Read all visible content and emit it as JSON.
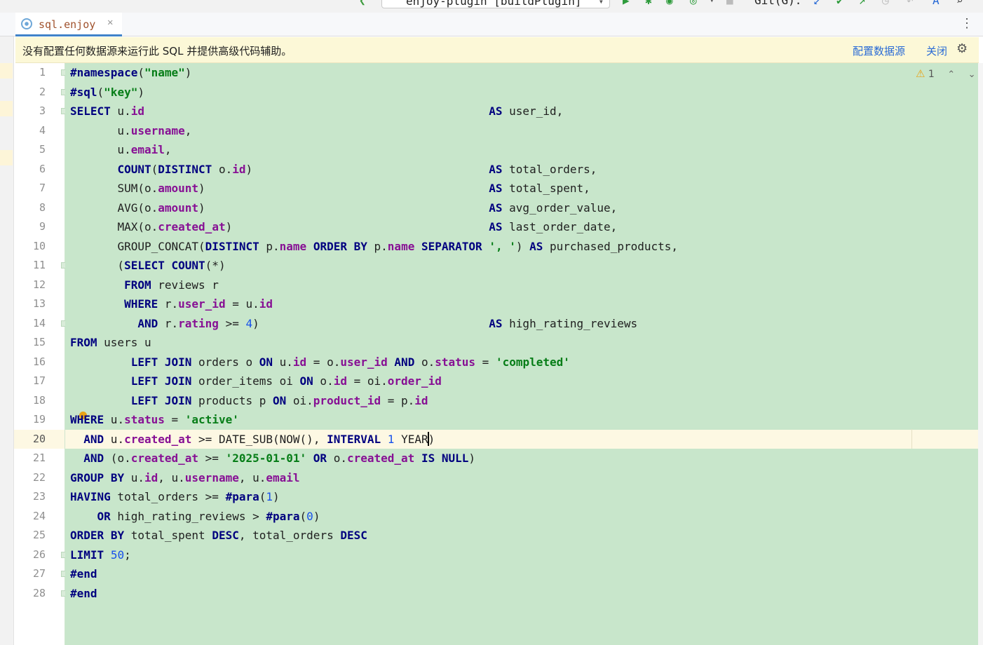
{
  "toolbar": {
    "run_config": "enjoy-plugin [buildPlugin]",
    "git_label": "Git(G):"
  },
  "tabs": [
    {
      "label": "sql.enjoy",
      "active": true
    }
  ],
  "banner": {
    "message": "没有配置任何数据源来运行此 SQL 并提供高级代码辅助。",
    "configure_link": "配置数据源",
    "close_link": "关闭"
  },
  "inspections": {
    "warning_count": "1"
  },
  "editor": {
    "current_line": 20,
    "lines": [
      "#namespace(\"name\")",
      "#sql(\"key\")",
      "SELECT u.id                                                   AS user_id,",
      "       u.username,",
      "       u.email,",
      "       COUNT(DISTINCT o.id)                                   AS total_orders,",
      "       SUM(o.amount)                                          AS total_spent,",
      "       AVG(o.amount)                                          AS avg_order_value,",
      "       MAX(o.created_at)                                      AS last_order_date,",
      "       GROUP_CONCAT(DISTINCT p.name ORDER BY p.name SEPARATOR ', ') AS purchased_products,",
      "       (SELECT COUNT(*)",
      "        FROM reviews r",
      "        WHERE r.user_id = u.id",
      "          AND r.rating >= 4)                                  AS high_rating_reviews",
      "FROM users u",
      "         LEFT JOIN orders o ON u.id = o.user_id AND o.status = 'completed'",
      "         LEFT JOIN order_items oi ON o.id = oi.order_id",
      "         LEFT JOIN products p ON oi.product_id = p.id",
      "WHERE u.status = 'active'",
      "  AND u.created_at >= DATE_SUB(NOW(), INTERVAL 1 YEAR)",
      "  AND (o.created_at >= '2025-01-01' OR o.created_at IS NULL)",
      "GROUP BY u.id, u.username, u.email",
      "HAVING total_orders >= #para(1)",
      "    OR high_rating_reviews > #para(0)",
      "ORDER BY total_spent DESC, total_orders DESC",
      "LIMIT 50;",
      "#end",
      "#end"
    ]
  },
  "colors": {
    "editor_bg": "#c8e6cb",
    "keyword": "#00007f",
    "string": "#067d17",
    "number": "#1750eb",
    "field": "#871094",
    "banner_bg": "#fcf8d7",
    "link": "#2a6bd6"
  }
}
